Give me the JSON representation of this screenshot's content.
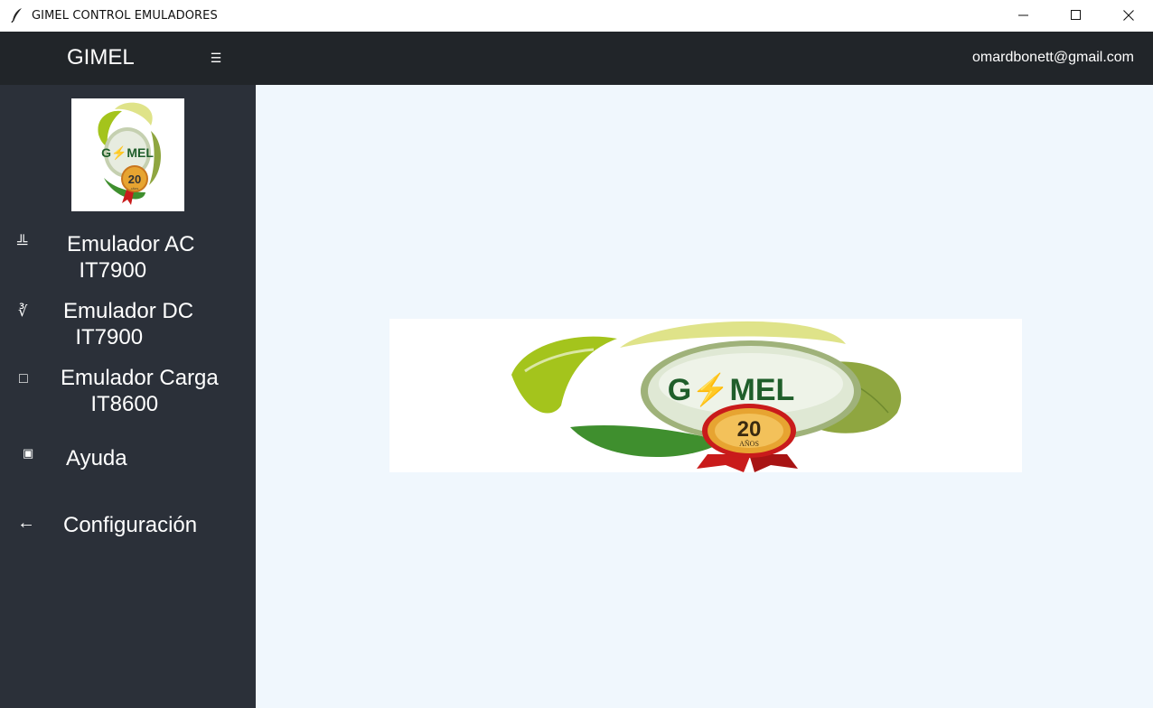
{
  "window": {
    "title": "GIMEL CONTROL EMULADORES",
    "app_icon": "feather-icon",
    "controls": {
      "minimize_icon": "minimize-icon",
      "maximize_icon": "maximize-icon",
      "close_icon": "close-icon"
    }
  },
  "header": {
    "brand": "GIMEL",
    "menu_toggle_glyph": "☰",
    "user_email": "omardbonett@gmail.com"
  },
  "sidebar": {
    "logo": {
      "brand_text": "G⚡MEL",
      "badge_number": "20",
      "badge_caption": "AÑOS"
    },
    "items": [
      {
        "label": "Emulador AC\n  IT7900",
        "icon": "ac-emulator-icon",
        "glyph": "╩"
      },
      {
        "label": "Emulador DC\n  IT7900",
        "icon": "dc-emulator-icon",
        "glyph": "∛"
      },
      {
        "label": "Emulador Carga\n     IT8600",
        "icon": "load-emulator-icon",
        "glyph": "□"
      },
      {
        "label": "Ayuda",
        "icon": "help-icon",
        "glyph": "▣"
      },
      {
        "label": "Configuración",
        "icon": "back-arrow-icon",
        "glyph": "←"
      }
    ]
  },
  "main": {
    "banner": {
      "brand_text": "G⚡MEL",
      "badge_number": "20",
      "badge_caption": "AÑOS"
    }
  },
  "colors": {
    "header_bg": "#212529",
    "sidebar_bg": "#2b3039",
    "content_bg": "#f0f7fd",
    "logo_green_light": "#a4c41c",
    "logo_green_dark": "#3f8f2e",
    "logo_olive": "#8fa640",
    "logo_yellow": "#dfe389",
    "badge_gold": "#e7a431",
    "ribbon_red": "#c91b1b"
  }
}
